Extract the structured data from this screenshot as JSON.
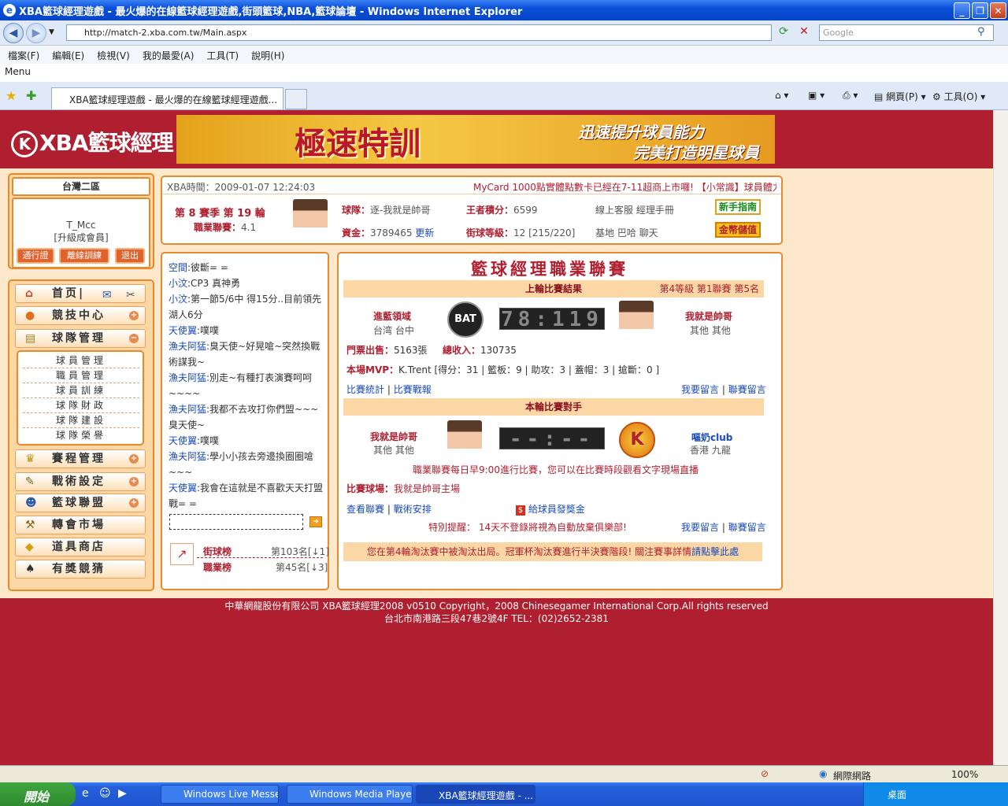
{
  "window": {
    "title": "XBA籃球經理遊戲 - 最火爆的在線籃球經理遊戲,街頭籃球,NBA,籃球論壇 - Windows Internet Explorer",
    "address": "http://match-2.xba.com.tw/Main.aspx",
    "search_placeholder": "Google",
    "menu": [
      "檔案(F)",
      "編輯(E)",
      "檢視(V)",
      "我的最愛(A)",
      "工具(T)",
      "說明(H)"
    ],
    "menu_label": "Menu",
    "tab_title": "XBA籃球經理遊戲 - 最火爆的在線籃球經理遊戲...",
    "toolbar": {
      "page": "網頁(P)",
      "tools": "工具(O)"
    }
  },
  "header": {
    "logo_text": "XBA籃球經理",
    "banner_title": "極速特訓",
    "banner_line1": "迅速提升球員能力",
    "banner_line2": "完美打造明星球員"
  },
  "sidebar": {
    "server": "台灣二區",
    "username": "T_Mcc",
    "upgrade": "[升級成會員]",
    "buttons": [
      "通行證",
      "離線訓練",
      "退出"
    ],
    "nav": [
      {
        "label": "首页|",
        "icon": "home-icon"
      },
      {
        "label": "競技中心",
        "icon": "basketball-icon"
      },
      {
        "label": "球隊管理",
        "icon": "clipboard-icon"
      }
    ],
    "submenu": [
      "球員管理",
      "職員管理",
      "球員訓練",
      "球隊財政",
      "球隊建設",
      "球隊榮譽"
    ],
    "nav2": [
      {
        "label": "賽程管理",
        "icon": "trophy-icon"
      },
      {
        "label": "戰術設定",
        "icon": "tactics-icon"
      },
      {
        "label": "籃球聯盟",
        "icon": "league-icon"
      },
      {
        "label": "轉會市場",
        "icon": "gavel-icon"
      },
      {
        "label": "道具商店",
        "icon": "shop-icon"
      },
      {
        "label": "有獎競猜",
        "icon": "spade-icon"
      }
    ]
  },
  "info": {
    "time": "XBA時間：2009-01-07 12:24:03",
    "marquee": "MyCard 1000點實體點數卡已經在7-11超商上市囉! 【小常識】球員體力i",
    "season": "第 8 賽季  第 19 輪",
    "league_label": "職業聯賽：",
    "league_value": "4.1",
    "team_label": "球隊：",
    "team_value": "逐-我就是帥哥",
    "funds_label": "資金：",
    "funds_value": "3789465",
    "funds_update": "更新",
    "points_label": "王者積分：",
    "points_value": "6599",
    "level_label": "街球等級：",
    "level_value": "12 [215/220]",
    "links1": "線上客服  經理手冊",
    "links2": "基地  巴哈  聊天",
    "guide_btn": "新手指南",
    "topup_btn": "金幣儲值"
  },
  "chat": {
    "lines": [
      {
        "user": "空間",
        "msg": ":彼斷= ="
      },
      {
        "user": "小汶",
        "msg": ":CP3 真神勇"
      },
      {
        "user": "小汶",
        "msg": ":第一節5/6中  得15分..目前領先湖人6分"
      },
      {
        "user": "天使翼",
        "msg": ":噗噗"
      },
      {
        "user": "漁夫阿猛",
        "msg": ":臭天使~好晃嗆~突然換戰術謀我~"
      },
      {
        "user": "漁夫阿猛",
        "msg": ":別走~有種打表演賽呵呵~~~~"
      },
      {
        "user": "漁夫阿猛",
        "msg": ":我都不去攻打你們盟~~~臭天使~"
      },
      {
        "user": "天使翼",
        "msg": ":噗噗"
      },
      {
        "user": "漁夫阿猛",
        "msg": ":學小小孩去旁邊換圈圈嗆~~~"
      },
      {
        "user": "天使翼",
        "msg": ":我會在這就是不喜歡天天打盟戰= ="
      }
    ],
    "rank1_label": "街球榜",
    "rank1_value": "第103名[↓1]",
    "rank2_label": "職業榜",
    "rank2_value": "第45名[↓3]"
  },
  "league": {
    "title": "籃球經理職業聯賽",
    "last_result": "上輪比賽結果",
    "level_info": "第4等級  第1聯賽  第5名",
    "home_team": "進藍領域",
    "home_loc": "台湾  台中",
    "home_logo": "BAT",
    "score": "78:119",
    "away_team": "我就是帥哥",
    "away_loc": "其他  其他",
    "tickets_label": "門票出售：",
    "tickets_value": "5163張",
    "income_label": "總收入：",
    "income_value": "130735",
    "mvp_label": "本場MVP：",
    "mvp_value": "K.Trent [得分：31 | 籃板：9 | 助攻：3 | 蓋帽：3 | 搶斷：0 ]",
    "stats_link": "比賽統計",
    "report_link": "比賽戰報",
    "msg_link": "我要留言",
    "league_msg_link": "聯賽留言",
    "next_opp": "本輪比賽對手",
    "next_home": "我就是帥哥",
    "next_home_loc": "其他  其他",
    "next_score": "--:--",
    "next_away": "嘔奶club",
    "next_away_loc": "香港  九龍",
    "schedule_note": "職業聯賽每日早9:00進行比賽，您可以在比賽時段觀看文字現場直播",
    "venue_label": "比賽球場：",
    "venue_value": "我就是帥哥主場",
    "view_league": "查看聯賽",
    "tactics": "戰術安排",
    "bonus": "給球員發獎金",
    "reminder": "特別提醒：  14天不登錄將視為自動放棄俱樂部!",
    "notice": "您在第4輪淘汰賽中被淘汰出局。冠軍杯淘汰賽進行半決賽階段! 關注賽事詳情",
    "notice_link": "請點擊此處"
  },
  "footer": {
    "line1": "中華網龍股份有限公司  XBA籃球經理2008 v0510    Copyright，2008 Chinesegamer International Corp.All rights reserved",
    "line2": "台北市南港路三段47巷2號4F TEL：(02)2652-2381"
  },
  "status": {
    "zone": "網際網路",
    "zoom": "100%"
  },
  "taskbar": {
    "start": "開始",
    "tasks": [
      "Windows Live Messen...",
      "Windows Media Player",
      "XBA籃球經理遊戲 - ..."
    ],
    "tray": "桌面"
  }
}
